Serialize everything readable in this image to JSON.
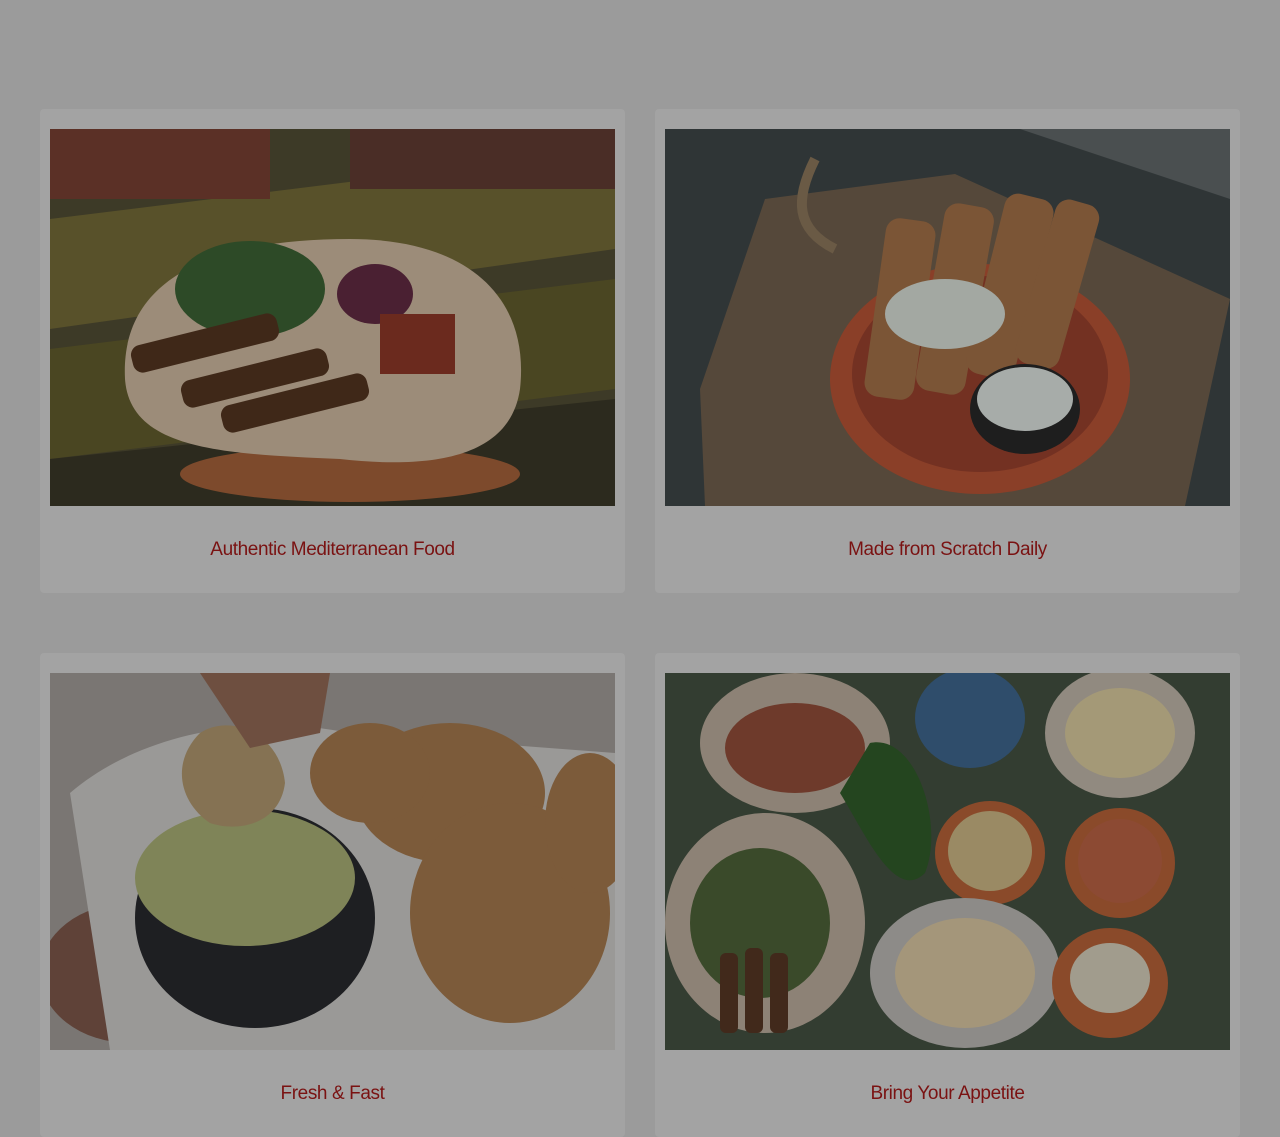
{
  "page": {
    "background": "#9b9b9b",
    "card_background": "#a3a3a3",
    "caption_color": "#7a1212"
  },
  "cards": [
    {
      "caption": "Authentic Mediterranean Food",
      "image": "wrap-with-skewers-photo"
    },
    {
      "caption": "Made from Scratch Daily",
      "image": "rolled-pastries-bowl-photo"
    },
    {
      "caption": "Fresh & Fast",
      "image": "dip-and-fritters-photo"
    },
    {
      "caption": "Bring Your Appetite",
      "image": "feast-table-photo"
    }
  ]
}
